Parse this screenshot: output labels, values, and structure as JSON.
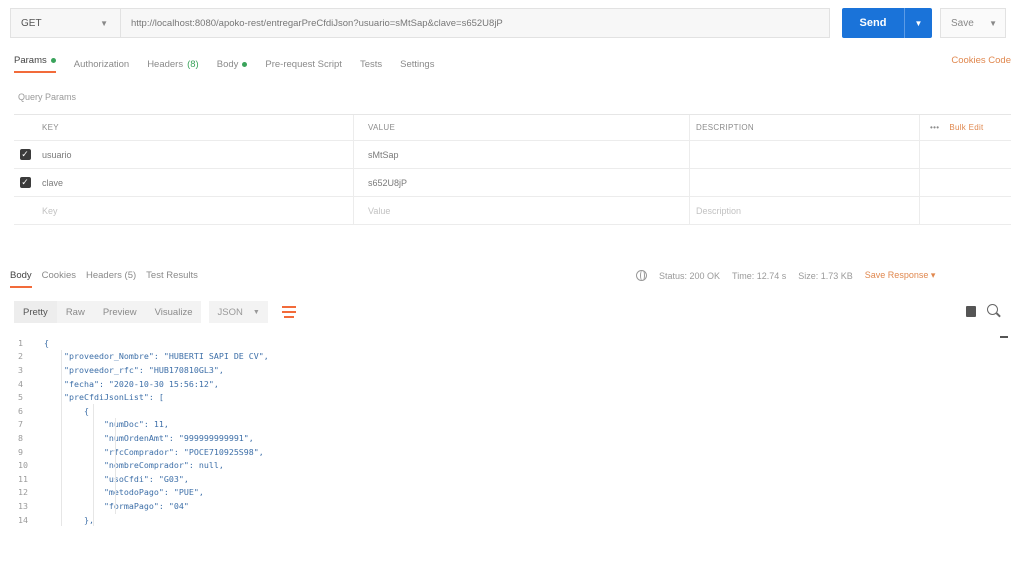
{
  "request": {
    "method": "GET",
    "url": "http://localhost:8080/apoko-rest/entregarPreCfdiJson?usuario=sMtSap&clave=s652U8jP",
    "send_label": "Send",
    "save_label": "Save"
  },
  "request_tabs": [
    {
      "label": "Params",
      "dot": true,
      "active": true
    },
    {
      "label": "Authorization"
    },
    {
      "label": "Headers",
      "count": "(8)"
    },
    {
      "label": "Body",
      "dot": true
    },
    {
      "label": "Pre-request Script"
    },
    {
      "label": "Tests"
    },
    {
      "label": "Settings"
    }
  ],
  "cookies_code": "Cookies  Code",
  "query_params_title": "Query Params",
  "params_table": {
    "headers": {
      "key": "KEY",
      "value": "VALUE",
      "description": "DESCRIPTION",
      "more": "•••",
      "bulk": "Bulk Edit"
    },
    "rows": [
      {
        "key": "usuario",
        "value": "sMtSap",
        "checked": true
      },
      {
        "key": "clave",
        "value": "s652U8jP",
        "checked": true
      }
    ],
    "placeholder": {
      "key": "Key",
      "value": "Value",
      "description": "Description"
    }
  },
  "response_tabs": [
    {
      "label": "Body",
      "active": true
    },
    {
      "label": "Cookies"
    },
    {
      "label": "Headers (5)"
    },
    {
      "label": "Test Results"
    }
  ],
  "response_meta": {
    "status": "Status: 200 OK",
    "time": "Time: 12.74 s",
    "size": "Size: 1.73 KB",
    "save_response": "Save Response ▾"
  },
  "format_tabs": [
    "Pretty",
    "Raw",
    "Preview",
    "Visualize"
  ],
  "language": "JSON",
  "code_lines": [
    "{",
    "    \"proveedor_Nombre\": \"HUBERTI SAPI DE CV\",",
    "    \"proveedor_rfc\": \"HUB170810GL3\",",
    "    \"fecha\": \"2020-10-30 15:56:12\",",
    "    \"preCfdiJsonList\": [",
    "        {",
    "            \"numDoc\": 11,",
    "            \"numOrdenAmt\": \"999999999991\",",
    "            \"rfcComprador\": \"POCE710925S98\",",
    "            \"nombreComprador\": null,",
    "            \"usoCfdi\": \"G03\",",
    "            \"metodoPago\": \"PUE\",",
    "            \"formaPago\": \"04\"",
    "        },"
  ]
}
